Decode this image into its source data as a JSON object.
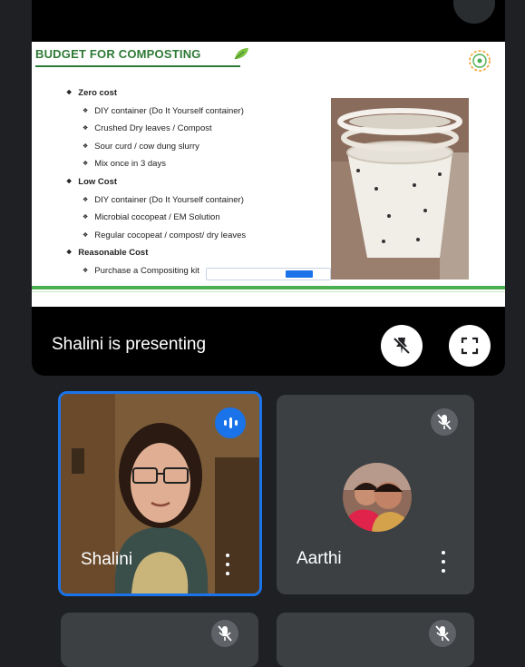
{
  "slide": {
    "title": "BUDGET FOR COMPOSTING",
    "sections": [
      {
        "heading": "Zero cost",
        "items": [
          "DIY container (Do It Yourself container)",
          "Crushed Dry leaves / Compost",
          "Sour curd / cow dung slurry",
          "Mix once in 3 days"
        ]
      },
      {
        "heading": "Low Cost",
        "items": [
          "DIY container (Do It Yourself container)",
          "Microbial cocopeat / EM Solution",
          "Regular cocopeat / compost/ dry leaves"
        ]
      },
      {
        "heading": "Reasonable Cost",
        "items": [
          "Purchase a Compositing kit"
        ]
      }
    ]
  },
  "presenting": {
    "label": "Shalini is presenting"
  },
  "participants": [
    {
      "name": "Shalini",
      "speaking": true
    },
    {
      "name": "Aarthi",
      "muted": true
    }
  ],
  "colors": {
    "accent": "#1a73e8",
    "tile_bg": "#3c4043",
    "slide_green": "#2f7a36"
  }
}
